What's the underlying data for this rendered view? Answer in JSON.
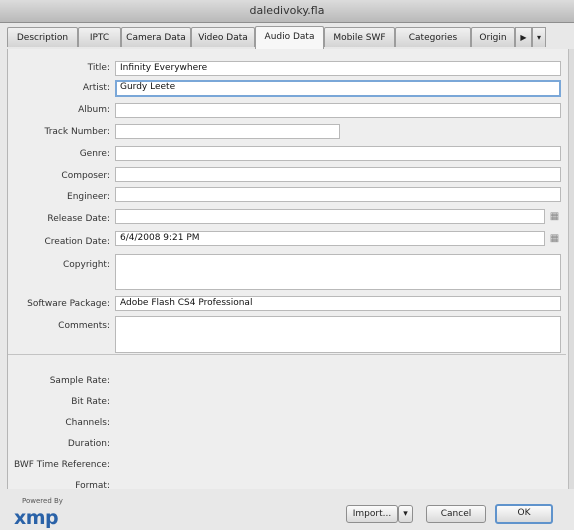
{
  "window": {
    "title": "daledivoky.fla"
  },
  "tabs": [
    {
      "label": "Description"
    },
    {
      "label": "IPTC"
    },
    {
      "label": "Camera Data"
    },
    {
      "label": "Video Data"
    },
    {
      "label": "Audio Data",
      "active": true
    },
    {
      "label": "Mobile SWF"
    },
    {
      "label": "Categories"
    },
    {
      "label": "Origin"
    }
  ],
  "tab_scroll": {
    "arrow": "▶",
    "more": "▾"
  },
  "fields": {
    "title": {
      "label": "Title:",
      "value": "Infinity Everywhere"
    },
    "artist": {
      "label": "Artist:",
      "value": "Gurdy Leete"
    },
    "album": {
      "label": "Album:",
      "value": ""
    },
    "track_number": {
      "label": "Track Number:",
      "value": ""
    },
    "genre": {
      "label": "Genre:",
      "value": ""
    },
    "composer": {
      "label": "Composer:",
      "value": ""
    },
    "engineer": {
      "label": "Engineer:",
      "value": ""
    },
    "release_date": {
      "label": "Release Date:",
      "value": ""
    },
    "creation_date": {
      "label": "Creation Date:",
      "value": "6/4/2008 9:21 PM"
    },
    "copyright": {
      "label": "Copyright:",
      "value": ""
    },
    "software_package": {
      "label": "Software Package:",
      "value": "Adobe Flash CS4 Professional"
    },
    "comments": {
      "label": "Comments:",
      "value": ""
    }
  },
  "info": {
    "sample_rate": "Sample Rate:",
    "bit_rate": "Bit Rate:",
    "channels": "Channels:",
    "duration": "Duration:",
    "bwf_time_reference": "BWF Time Reference:",
    "format": "Format:"
  },
  "icons": {
    "calendar": "calendar-icon"
  },
  "footer": {
    "powered_by": "Powered By",
    "xmp_logo": "xmp",
    "import_label": "Import...",
    "import_dropdown": "▾",
    "cancel_label": "Cancel",
    "ok_label": "OK"
  },
  "colors": {
    "focus": "#7aa7d8",
    "xmp_blue": "#2a62a8"
  }
}
